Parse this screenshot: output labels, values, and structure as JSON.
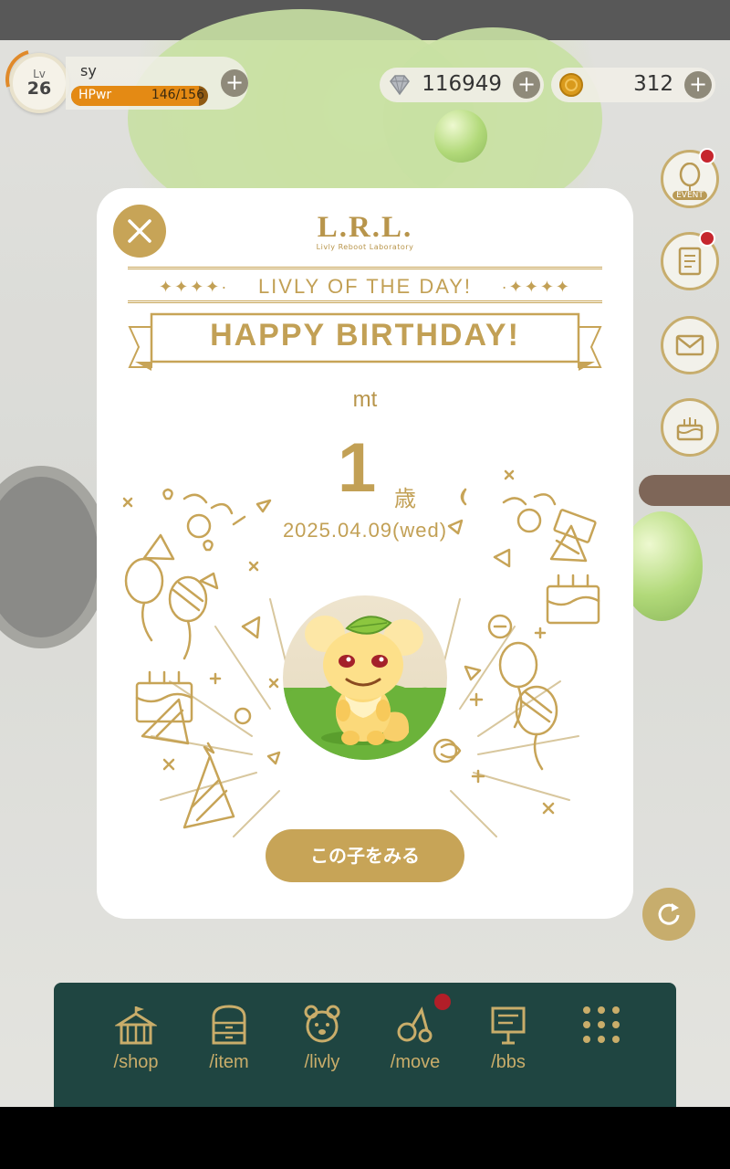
{
  "player": {
    "level_label": "Lv",
    "level": "26",
    "username": "sy",
    "hp_label": "HPwr",
    "hp_value": "146/156",
    "hp_fraction": 0.936
  },
  "currency": {
    "gems": "116949",
    "coins": "312"
  },
  "side_buttons": {
    "event_label": "EVENT"
  },
  "modal": {
    "logo_main": "L.R.L.",
    "logo_sub": "Livly Reboot Laboratory",
    "stars_left": "✦✦✦✦·",
    "stars_right": "·✦✦✦✦",
    "heading": "LIVLY OF THE DAY!",
    "banner": "HAPPY BIRTHDAY!",
    "livly_name": "mt",
    "age_number": "1",
    "age_unit": "歳",
    "date": "2025.04.09(wed)",
    "view_button": "この子をみる"
  },
  "nav": {
    "items": [
      {
        "label": "/shop",
        "icon": "shop-tent-icon"
      },
      {
        "label": "/item",
        "icon": "item-cabinet-icon"
      },
      {
        "label": "/livly",
        "icon": "livly-bear-icon"
      },
      {
        "label": "/move",
        "icon": "move-icon"
      },
      {
        "label": "/bbs",
        "icon": "bbs-board-icon"
      },
      {
        "label": "",
        "icon": "menu-grid-icon"
      }
    ]
  },
  "colors": {
    "accent_gold": "#c7a457",
    "nav_bg": "#1f4541",
    "hp_orange": "#e48a14",
    "notification_red": "#c6262e"
  }
}
